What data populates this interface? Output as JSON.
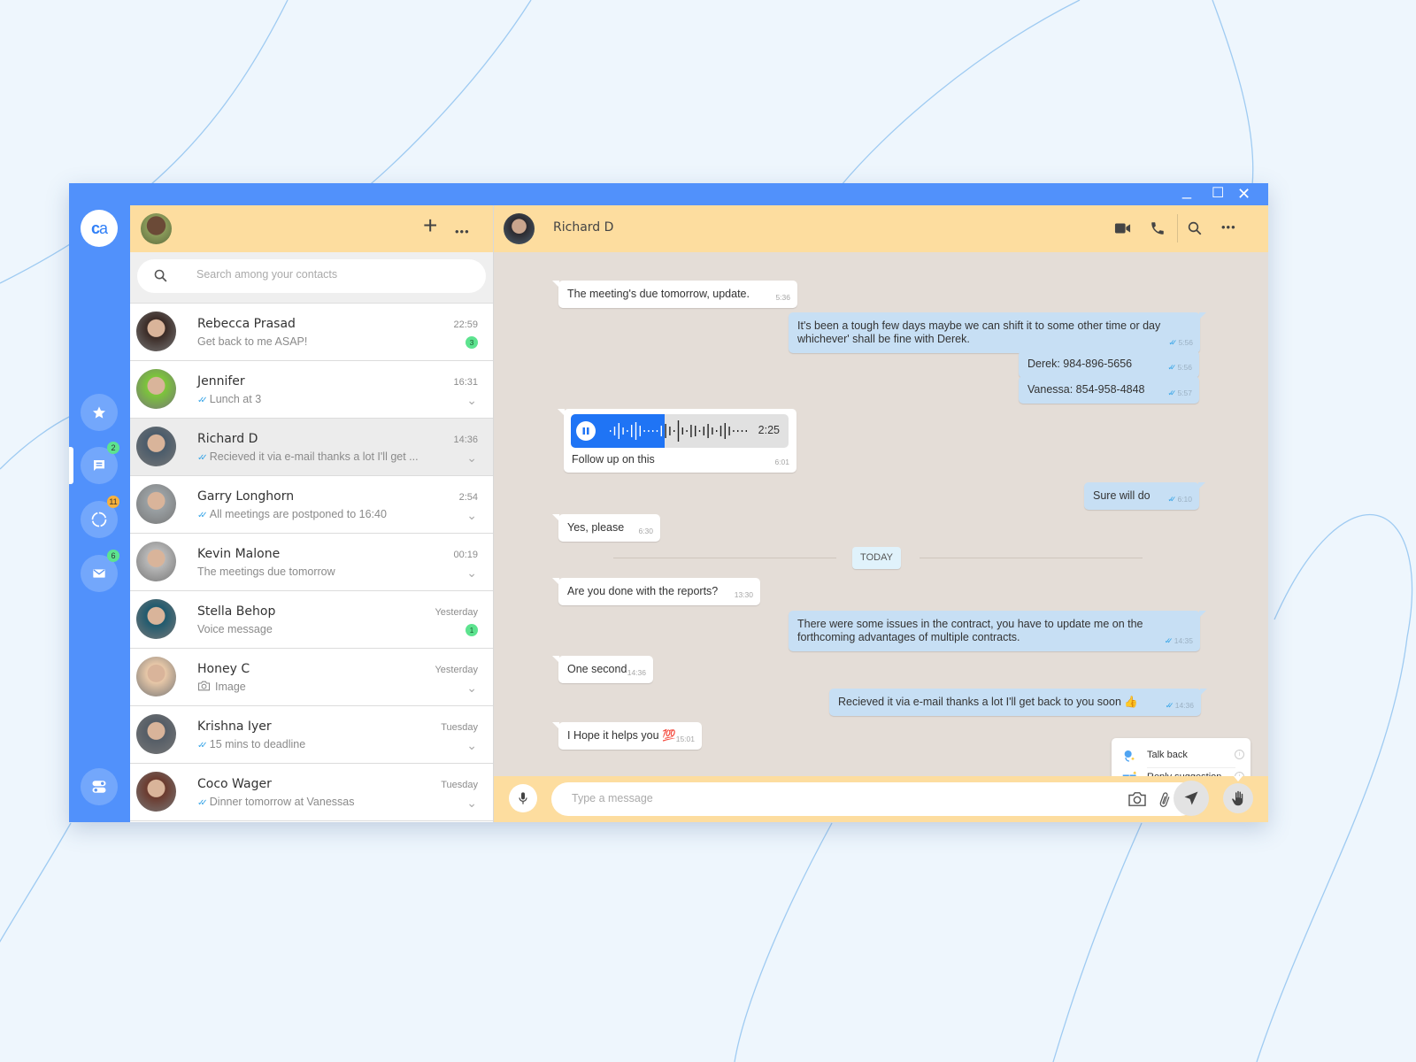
{
  "app": {
    "logo_text_bold": "c",
    "logo_text_light": "a",
    "window_controls": {
      "minimize": "_",
      "maximize": "☐",
      "close": "✕"
    },
    "accent_color": "#5191fb",
    "header_color": "#fddd9f"
  },
  "rail": {
    "items": [
      {
        "name": "favorites",
        "icon": "star-icon",
        "badge": null
      },
      {
        "name": "chats",
        "icon": "chat-icon",
        "badge": "2",
        "badge_color": "#5de38f",
        "active": true
      },
      {
        "name": "status",
        "icon": "status-ring-icon",
        "badge": "11",
        "badge_color": "#f8b13c"
      },
      {
        "name": "mail",
        "icon": "mail-icon",
        "badge": "6",
        "badge_color": "#5de38f"
      }
    ],
    "bottom_icon": "toggle-settings-icon"
  },
  "sidebar": {
    "new_chat_icon": "+",
    "more_icon": "•••",
    "search_placeholder": "Search among your contacts",
    "chats": [
      {
        "name": "Rebecca Prasad",
        "preview": "Get back to me ASAP!",
        "time": "22:59",
        "badge": "3",
        "read_ticks": false,
        "avatar_color": "#3a2a25"
      },
      {
        "name": "Jennifer",
        "preview": "Lunch at 3",
        "time": "16:31",
        "badge": null,
        "read_ticks": true,
        "avatar_color": "#7cc63a"
      },
      {
        "name": "Richard D",
        "preview": "Recieved it via e-mail thanks a lot I'll get ...",
        "time": "14:36",
        "badge": null,
        "read_ticks": true,
        "active": true,
        "avatar_color": "#4a5b6a"
      },
      {
        "name": "Garry Longhorn",
        "preview": "All meetings are postponed to 16:40",
        "time": "2:54",
        "badge": null,
        "read_ticks": true,
        "avatar_color": "#9aa0a3"
      },
      {
        "name": "Kevin Malone",
        "preview": "The meetings due tomorrow",
        "time": "00:19",
        "badge": null,
        "read_ticks": false,
        "avatar_color": "#b7b7b7"
      },
      {
        "name": "Stella Behop",
        "preview": "Voice message",
        "time": "Yesterday",
        "badge": "1",
        "read_ticks": false,
        "avatar_color": "#1f5a6e"
      },
      {
        "name": "Honey C",
        "preview": "Image",
        "preview_icon": "camera-icon",
        "time": "Yesterday",
        "badge": null,
        "read_ticks": false,
        "avatar_color": "#e8c8a8"
      },
      {
        "name": "Krishna Iyer",
        "preview": "15 mins to deadline",
        "time": "Tuesday",
        "badge": null,
        "read_ticks": true,
        "avatar_color": "#555d66"
      },
      {
        "name": "Coco Wager",
        "preview": "Dinner tomorrow at Vanessas",
        "time": "Tuesday",
        "badge": null,
        "read_ticks": true,
        "avatar_color": "#6b3a2e"
      }
    ]
  },
  "conversation": {
    "contact_name": "Richard D",
    "header_icons": [
      "video-call-icon",
      "phone-icon",
      "search-icon",
      "more-icon"
    ],
    "messages": [
      {
        "dir": "in",
        "text": "The meeting's due tomorrow, update.",
        "time": "5:36"
      },
      {
        "dir": "out",
        "text": "It's been a tough few days maybe we can shift it to some other time or day whichever' shall be fine with Derek.",
        "time": "5:56"
      },
      {
        "dir": "out",
        "text": "Derek: 984-896-5656",
        "time": "5:56"
      },
      {
        "dir": "out",
        "text": "Vanessa: 854-958-4848",
        "time": "5:57"
      },
      {
        "dir": "in",
        "type": "voice",
        "duration": "2:25",
        "progress": 0.43,
        "caption": "Follow up on this",
        "time": "6:01"
      },
      {
        "dir": "out",
        "text": "Sure will do",
        "time": "6:10"
      },
      {
        "dir": "in",
        "text": "Yes, please",
        "time": "6:30"
      },
      {
        "dir": "in",
        "text": "Are you done with the reports?",
        "time": "13:30"
      },
      {
        "dir": "out",
        "text": "There were some issues in the contract, you have to update me on the forthcoming advantages of multiple contracts.",
        "time": "14:35"
      },
      {
        "dir": "in",
        "text": "One second",
        "time": "14:36"
      },
      {
        "dir": "out",
        "text": "Recieved it via e-mail thanks a lot I'll get back to you soon 👍",
        "time": "14:36"
      },
      {
        "dir": "in",
        "text": "I Hope it helps you 💯",
        "time": "15:01"
      }
    ],
    "date_divider": "TODAY",
    "suggestions": [
      {
        "label": "Talk back",
        "icon": "talk-back-icon"
      },
      {
        "label": "Reply suggestion",
        "icon": "reply-suggestion-icon"
      }
    ],
    "composer": {
      "placeholder": "Type a message",
      "icons": [
        "mic-icon",
        "camera-icon",
        "attach-icon",
        "send-icon",
        "hand-icon"
      ]
    }
  }
}
